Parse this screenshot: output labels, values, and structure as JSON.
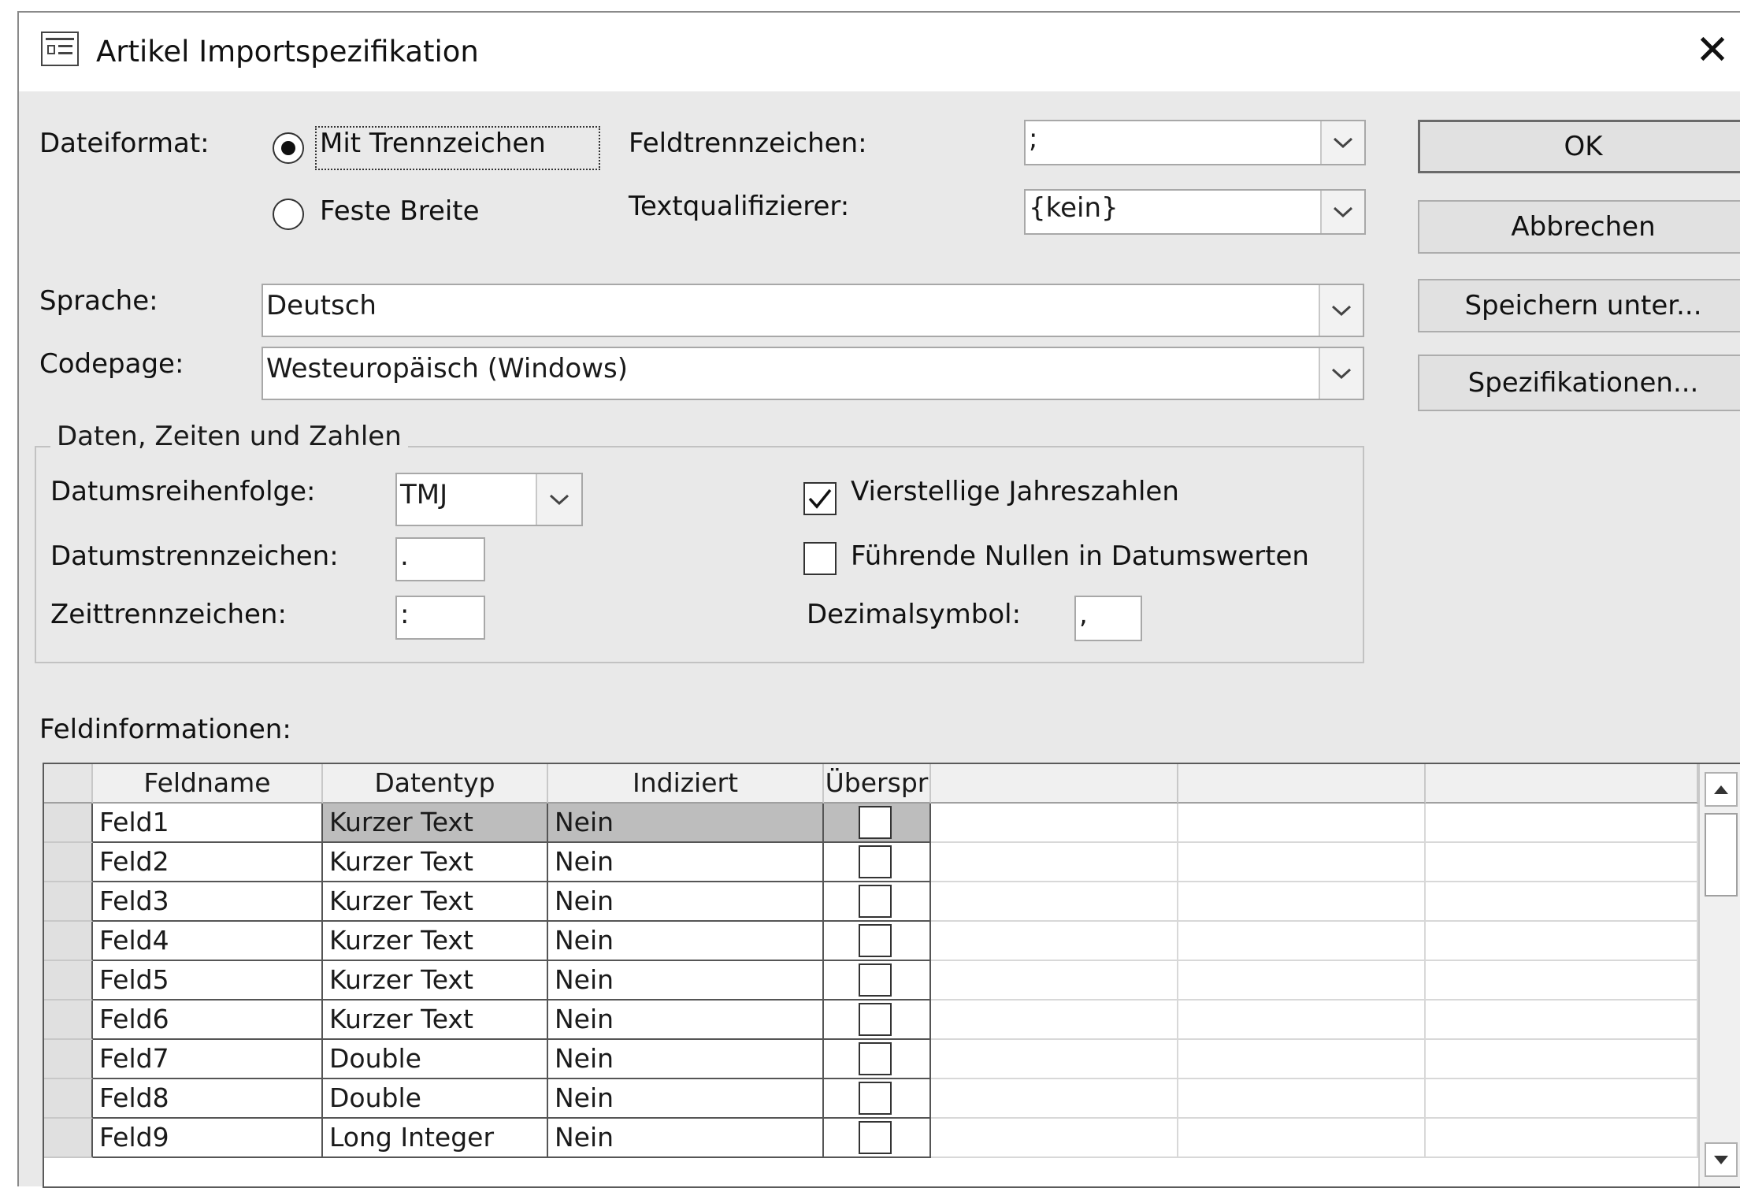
{
  "window": {
    "title": "Artikel Importspezifikation",
    "close_glyph": "✕"
  },
  "format": {
    "label": "Dateiformat:",
    "delimited": "Mit Trennzeichen",
    "fixed": "Feste Breite",
    "selected": "delimited"
  },
  "field_delimiter": {
    "label": "Feldtrennzeichen:",
    "value": ";"
  },
  "text_qualifier": {
    "label": "Textqualifizierer:",
    "value": "{kein}"
  },
  "language": {
    "label": "Sprache:",
    "value": "Deutsch"
  },
  "codepage": {
    "label": "Codepage:",
    "value": "Westeuropäisch (Windows)"
  },
  "buttons": {
    "ok": "OK",
    "cancel": "Abbrechen",
    "save_as": "Speichern unter...",
    "specs": "Spezifikationen..."
  },
  "dates_group": {
    "title": "Daten, Zeiten und Zahlen",
    "date_order_label": "Datumsreihenfolge:",
    "date_order_value": "TMJ",
    "date_sep_label": "Datumstrennzeichen:",
    "date_sep_value": ".",
    "time_sep_label": "Zeittrennzeichen:",
    "time_sep_value": ":",
    "four_digit_years_label": "Vierstellige Jahreszahlen",
    "four_digit_years_checked": true,
    "leading_zeros_label": "Führende Nullen in Datumswerten",
    "leading_zeros_checked": false,
    "decimal_label": "Dezimalsymbol:",
    "decimal_value": ","
  },
  "fields": {
    "label": "Feldinformationen:",
    "columns": [
      "Feldname",
      "Datentyp",
      "Indiziert",
      "Überspr"
    ],
    "rows": [
      [
        "Feld1",
        "Kurzer Text",
        "Nein"
      ],
      [
        "Feld2",
        "Kurzer Text",
        "Nein"
      ],
      [
        "Feld3",
        "Kurzer Text",
        "Nein"
      ],
      [
        "Feld4",
        "Kurzer Text",
        "Nein"
      ],
      [
        "Feld5",
        "Kurzer Text",
        "Nein"
      ],
      [
        "Feld6",
        "Kurzer Text",
        "Nein"
      ],
      [
        "Feld7",
        "Double",
        "Nein"
      ],
      [
        "Feld8",
        "Double",
        "Nein"
      ],
      [
        "Feld9",
        "Long Integer",
        "Nein"
      ]
    ],
    "skip_checked": [
      false,
      false,
      false,
      false,
      false,
      false,
      false,
      false,
      false
    ]
  },
  "icons": {
    "window": "form-icon",
    "dropdown": "chevron-down-icon",
    "scroll_up": "arrow-up-icon",
    "scroll_down": "arrow-down-icon"
  }
}
